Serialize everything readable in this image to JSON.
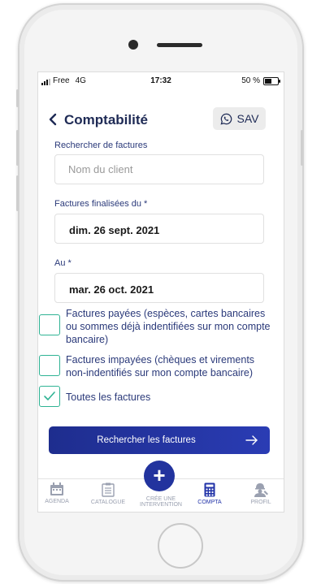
{
  "status_bar": {
    "carrier": "Free",
    "network": "4G",
    "time": "17:32",
    "battery": "50 %"
  },
  "header": {
    "title": "Comptabilité",
    "sav_label": "SAV"
  },
  "search": {
    "label": "Rechercher de factures",
    "placeholder": "Nom du client"
  },
  "date_from": {
    "label": "Factures finalisées du *",
    "value": "dim. 26 sept. 2021"
  },
  "date_to": {
    "label": "Au *",
    "value": "mar. 26 oct. 2021"
  },
  "filters": [
    {
      "label_line1": "Factures payées (espèces, cartes bancaires",
      "label_line2": "ou sommes déjà indentifiées sur mon compte",
      "label_line3": "bancaire)",
      "checked": false
    },
    {
      "label_line1": "Factures impayées (chèques et virements",
      "label_line2": "non-indentifiés sur mon compte bancaire)",
      "checked": false
    },
    {
      "label_line1": "Toutes les factures",
      "checked": true
    }
  ],
  "search_button": {
    "label": "Rechercher les factures"
  },
  "tabs": [
    {
      "label": "AGENDA",
      "icon": "calendar-icon"
    },
    {
      "label": "CATALOGUE",
      "icon": "clipboard-icon"
    },
    {
      "label_line1": "CRÉE UNE",
      "label_line2": "INTERVENTION",
      "icon": "plus-icon"
    },
    {
      "label": "COMPTA",
      "icon": "calculator-icon",
      "active": true
    },
    {
      "label": "PROFIL",
      "icon": "worker-icon"
    }
  ],
  "colors": {
    "primary": "#22339e",
    "accent": "#2fb394",
    "text": "#1e2a55"
  }
}
